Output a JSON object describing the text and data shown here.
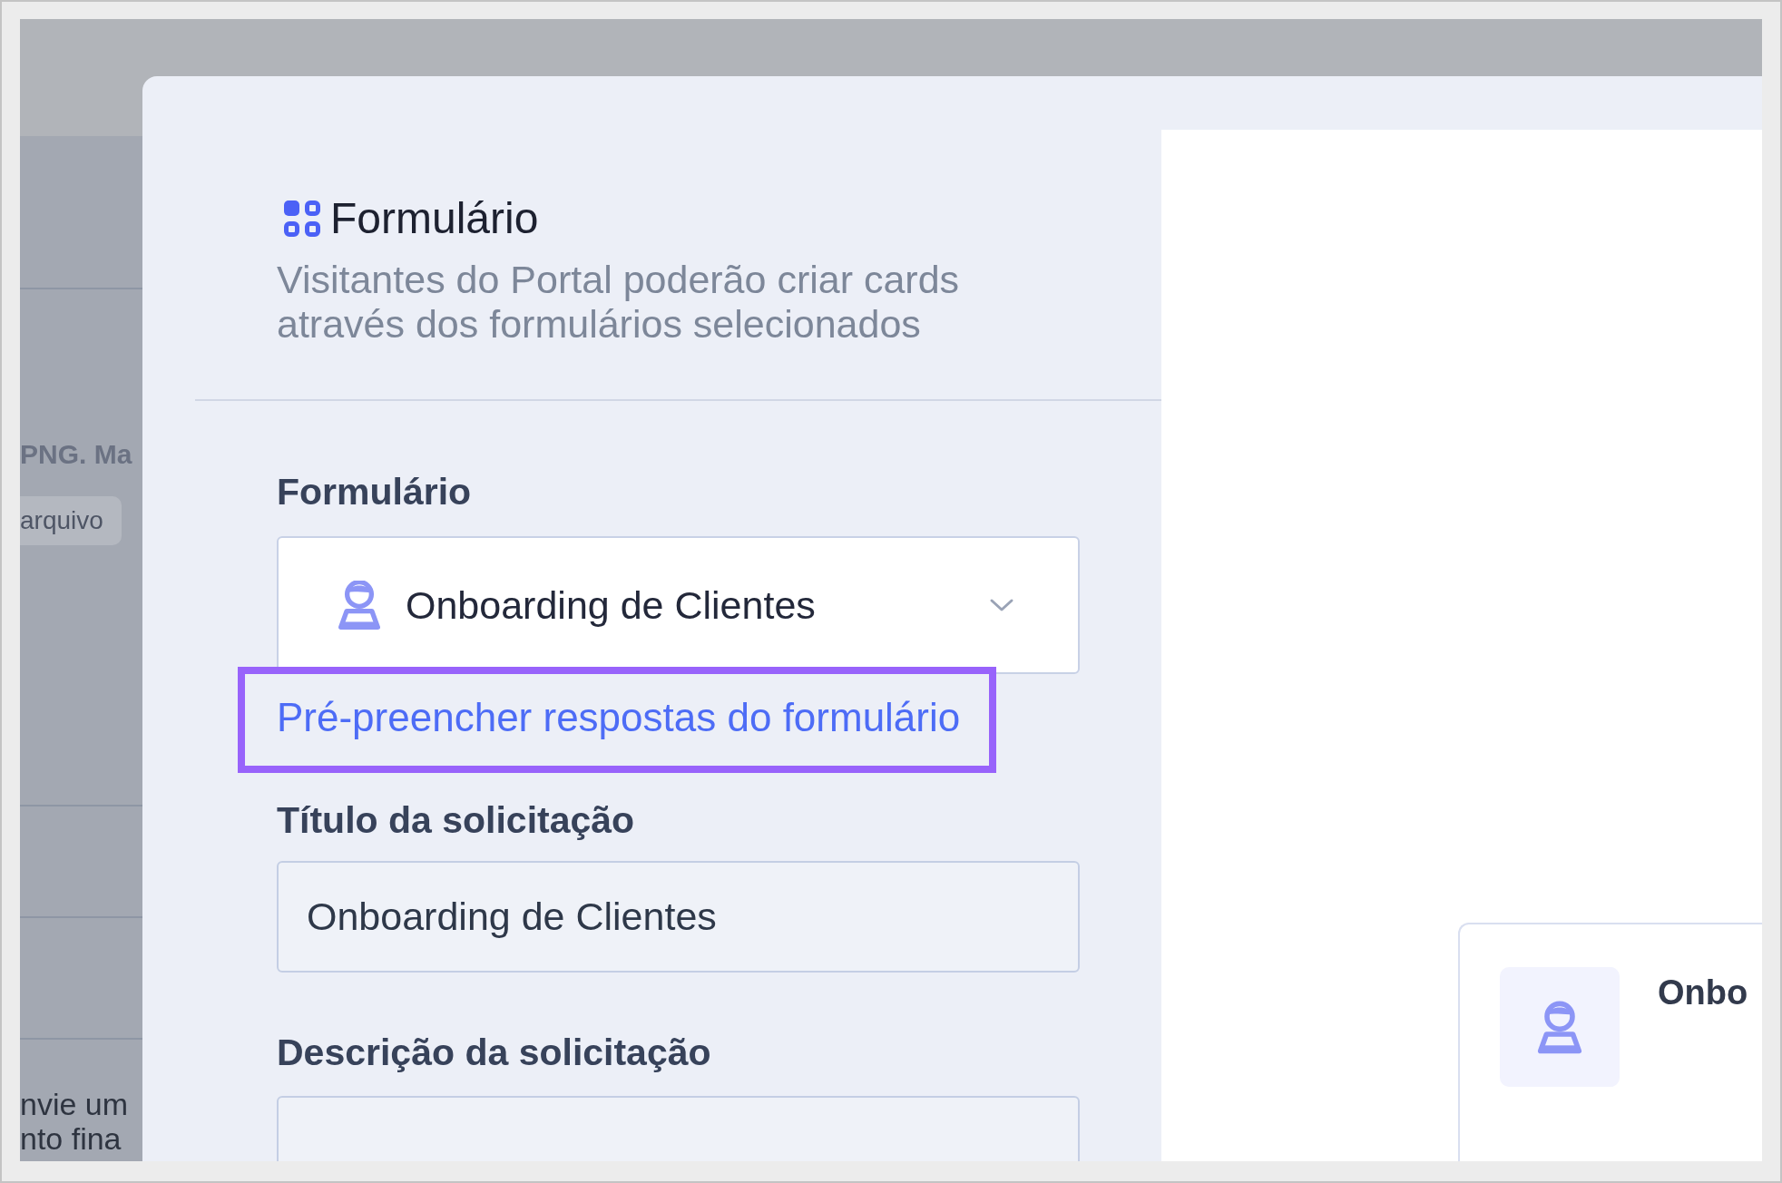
{
  "background_page": {
    "file_hint": "PNG. Ma",
    "upload_button": "arquivo",
    "note_lines": [
      "nvie um",
      "nto fina"
    ]
  },
  "modal": {
    "section": {
      "title": "Formulário",
      "description": "Visitantes do Portal poderão criar cards através dos formulários selecionados"
    },
    "fields": [
      {
        "kind": "select",
        "label": "Formulário",
        "value": "Onboarding de Clientes",
        "link": {
          "text": "Pré-preencher respostas do formulário",
          "highlighted": true
        }
      },
      {
        "kind": "text",
        "label": "Título da solicitação",
        "value": "Onboarding de Clientes"
      },
      {
        "kind": "textarea",
        "label": "Descrição da solicitação"
      }
    ],
    "preview_card": {
      "title": "Onbo"
    }
  }
}
